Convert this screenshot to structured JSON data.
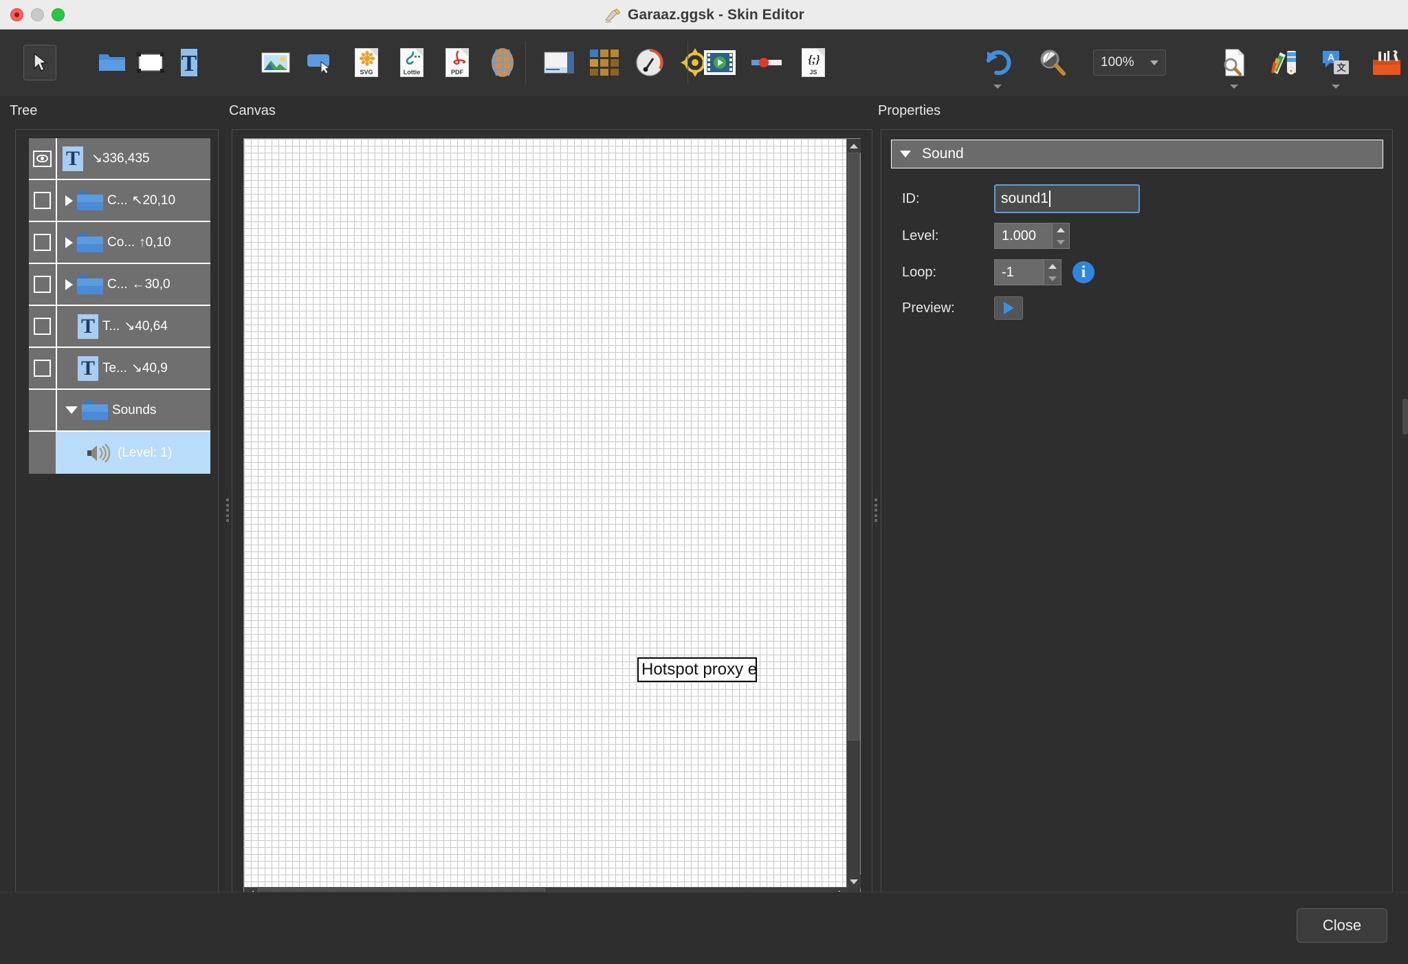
{
  "window": {
    "title": "Garaaz.ggsk - Skin Editor",
    "logo_icon": "app-logo-icon",
    "controls": {
      "close": "close-window",
      "minimize": "minimize-window",
      "maximize": "maximize-window"
    }
  },
  "toolbar": {
    "zoom_value": "100%",
    "groups": [
      {
        "name": "select",
        "items": [
          {
            "icon": "pointer-arrow-icon",
            "selected": true
          }
        ]
      },
      {
        "name": "containers",
        "items": [
          {
            "icon": "folder-icon"
          },
          {
            "icon": "rectangle-icon"
          },
          {
            "icon": "text-icon"
          }
        ]
      },
      {
        "name": "media",
        "items": [
          {
            "icon": "image-icon"
          },
          {
            "icon": "button-icon"
          },
          {
            "icon": "svg-file-icon",
            "label": "SVG"
          },
          {
            "icon": "lottie-file-icon",
            "label": "Lottie"
          },
          {
            "icon": "pdf-file-icon",
            "label": "PDF"
          },
          {
            "icon": "globe-icon"
          }
        ]
      },
      {
        "name": "views",
        "items": [
          {
            "icon": "window-layout-icon"
          },
          {
            "icon": "thumbnail-grid-icon"
          },
          {
            "icon": "compass-gauge-icon"
          },
          {
            "icon": "target-crosshair-icon"
          }
        ]
      },
      {
        "name": "playback",
        "items": [
          {
            "icon": "video-player-icon"
          },
          {
            "icon": "slider-icon"
          },
          {
            "icon": "js-file-icon",
            "label": "JS"
          }
        ]
      },
      {
        "name": "history",
        "items": [
          {
            "icon": "undo-icon",
            "has_dropdown": true
          },
          {
            "icon": "zoom-tool-icon"
          }
        ]
      },
      {
        "name": "tools",
        "items": [
          {
            "icon": "document-search-icon",
            "has_dropdown": true
          },
          {
            "icon": "color-palette-icon"
          },
          {
            "icon": "translate-icon",
            "has_dropdown": true
          },
          {
            "icon": "toolbox-icon"
          }
        ]
      }
    ]
  },
  "tree": {
    "label": "Tree",
    "items": [
      {
        "visibility": "eye",
        "icon": "text-item-icon",
        "name": "",
        "coords": "↘336,435",
        "type": "text",
        "expandable": false,
        "selected": false
      },
      {
        "visibility": "checkbox",
        "icon": "folder-item-icon",
        "name": "C...",
        "coords": "↖20,10",
        "type": "folder",
        "expandable": true,
        "expanded": false,
        "selected": false
      },
      {
        "visibility": "checkbox",
        "icon": "folder-item-icon",
        "name": "Co...",
        "coords": "↑0,10",
        "type": "folder",
        "expandable": true,
        "expanded": false,
        "selected": false
      },
      {
        "visibility": "checkbox",
        "icon": "folder-item-icon",
        "name": "C...",
        "coords": "←30,0",
        "type": "folder",
        "expandable": true,
        "expanded": false,
        "selected": false
      },
      {
        "visibility": "checkbox",
        "icon": "text-item-icon",
        "name": "T...",
        "coords": "↘40,64",
        "type": "text",
        "expandable": false,
        "selected": false
      },
      {
        "visibility": "checkbox",
        "icon": "text-item-icon",
        "name": "Te...",
        "coords": "↘40,9",
        "type": "text",
        "expandable": false,
        "selected": false
      },
      {
        "visibility": "none",
        "icon": "folder-item-icon",
        "name": "Sounds",
        "coords": "",
        "type": "folder",
        "expandable": true,
        "expanded": true,
        "selected": false
      },
      {
        "visibility": "none",
        "icon": "speaker-icon",
        "name": "(Level: 1)",
        "coords": "",
        "type": "sound",
        "expandable": false,
        "selected": true,
        "indent": true
      }
    ]
  },
  "canvas": {
    "label": "Canvas",
    "hotspot_text": "Hotspot proxy e",
    "scrollbars": {
      "vertical": "canvas-vscrollbar",
      "horizontal": "canvas-hscrollbar"
    }
  },
  "properties": {
    "label": "Properties",
    "section_title": "Sound",
    "section_expanded": true,
    "fields": [
      {
        "label": "ID:",
        "value": "sound1",
        "type": "text",
        "focused": true
      },
      {
        "label": "Level:",
        "value": "1.000",
        "type": "spinner"
      },
      {
        "label": "Loop:",
        "value": "-1",
        "type": "spinner",
        "info": "info-icon"
      },
      {
        "label": "Preview:",
        "value": "",
        "type": "play-button"
      }
    ]
  },
  "footer": {
    "close_label": "Close"
  },
  "colors": {
    "window_bg": "#2e2e2e",
    "toolbar_bg": "#333333",
    "titlebar_bg": "#ececec",
    "tree_row_bg": "#6f6f6f",
    "tree_selected_bg": "#b9dcfb",
    "accent_blue": "#5c9ddf",
    "text_light": "#ffffff"
  }
}
